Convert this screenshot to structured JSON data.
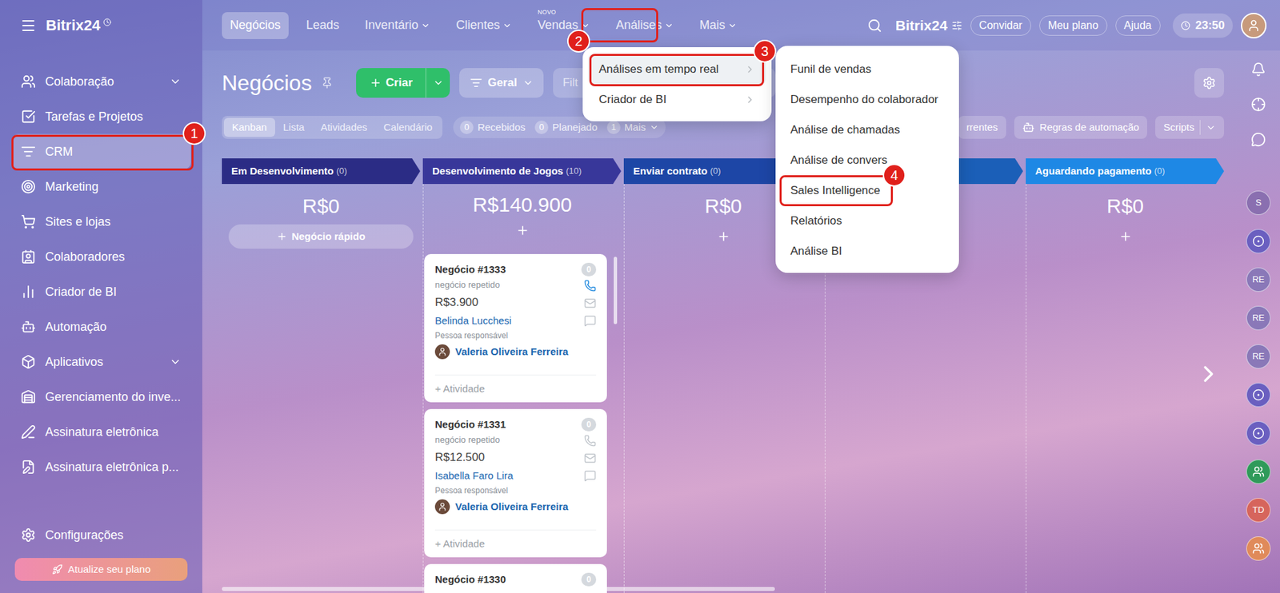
{
  "sidebar": {
    "logo": "Bitrix24",
    "items": [
      {
        "label": "Colaboração",
        "expandable": true,
        "selected": false
      },
      {
        "label": "Tarefas e Projetos",
        "expandable": false,
        "selected": false
      },
      {
        "label": "CRM",
        "expandable": false,
        "selected": true
      },
      {
        "label": "Marketing",
        "expandable": false,
        "selected": false
      },
      {
        "label": "Sites e lojas",
        "expandable": false,
        "selected": false
      },
      {
        "label": "Colaboradores",
        "expandable": false,
        "selected": false
      },
      {
        "label": "Criador de BI",
        "expandable": false,
        "selected": false
      },
      {
        "label": "Automação",
        "expandable": false,
        "selected": false
      },
      {
        "label": "Aplicativos",
        "expandable": true,
        "selected": false
      },
      {
        "label": "Gerenciamento do inve...",
        "expandable": false,
        "selected": false
      },
      {
        "label": "Assinatura eletrônica",
        "expandable": false,
        "selected": false
      },
      {
        "label": "Assinatura eletrônica p...",
        "expandable": false,
        "selected": false
      }
    ],
    "settings": "Configurações",
    "upgrade": "Atualize seu plano"
  },
  "topnav": {
    "tabs": [
      {
        "label": "Negócios",
        "selected": true,
        "dropdown": false,
        "badge": ""
      },
      {
        "label": "Leads",
        "selected": false,
        "dropdown": false,
        "badge": ""
      },
      {
        "label": "Inventário",
        "selected": false,
        "dropdown": true,
        "badge": ""
      },
      {
        "label": "Clientes",
        "selected": false,
        "dropdown": true,
        "badge": ""
      },
      {
        "label": "Vendas",
        "selected": false,
        "dropdown": true,
        "badge": "NOVO"
      },
      {
        "label": "Análises",
        "selected": false,
        "dropdown": true,
        "badge": ""
      },
      {
        "label": "Mais",
        "selected": false,
        "dropdown": true,
        "badge": ""
      }
    ],
    "brand": "Bitrix24",
    "buttons": [
      "Convidar",
      "Meu plano",
      "Ajuda"
    ],
    "time": "23:50"
  },
  "page": {
    "title": "Negócios",
    "create": "Criar",
    "preset": "Geral",
    "filter_placeholder": "Filt",
    "view_tabs": [
      {
        "label": "Kanban",
        "selected": true
      },
      {
        "label": "Lista",
        "selected": false
      },
      {
        "label": "Atividades",
        "selected": false
      },
      {
        "label": "Calendário",
        "selected": false
      }
    ],
    "counters": [
      {
        "count": "0",
        "label": "Recebidos",
        "dropdown": false
      },
      {
        "count": "0",
        "label": "Planejado",
        "dropdown": false
      },
      {
        "count": "1",
        "label": "Mais",
        "dropdown": true
      }
    ],
    "tools": [
      {
        "label": "rrentes",
        "dropdown": false
      },
      {
        "label": "Regras de automação",
        "dropdown": false
      },
      {
        "label": "Scripts",
        "dropdown": true
      }
    ]
  },
  "columns": [
    {
      "title": "Em Desenvolvimento",
      "count": "(0)",
      "amount": "R$0",
      "quick_add": "Negócio rápido",
      "color": "#2b2c85",
      "cards": []
    },
    {
      "title": "Desenvolvimento de Jogos",
      "count": "(10)",
      "amount": "R$140.900",
      "quick_add": "",
      "color": "#38379a",
      "cards": [
        {
          "title": "Negócio #1333",
          "count": "0",
          "subtitle": "negócio repetido",
          "amount": "R$3.900",
          "client": "Belinda Lucchesi",
          "role": "Pessoa responsável",
          "responsible": "Valeria Oliveira Ferreira",
          "action": "+ Atividade",
          "phone_active": true
        },
        {
          "title": "Negócio #1331",
          "count": "0",
          "subtitle": "negócio repetido",
          "amount": "R$12.500",
          "client": "Isabella Faro Lira",
          "role": "Pessoa responsável",
          "responsible": "Valeria Oliveira Ferreira",
          "action": "+ Atividade",
          "phone_active": false
        },
        {
          "title": "Negócio #1330",
          "count": "0",
          "subtitle": "",
          "amount": "",
          "client": "",
          "role": "",
          "responsible": "",
          "action": "",
          "phone_active": false
        }
      ]
    },
    {
      "title": "Enviar contrato",
      "count": "(0)",
      "amount": "R$0",
      "quick_add": "",
      "color": "#1d46a6",
      "cards": []
    },
    {
      "title": "",
      "count": "",
      "amount": "",
      "quick_add": "",
      "color": "#1b5fb8",
      "cards": []
    },
    {
      "title": "Aguardando pagamento",
      "count": "(0)",
      "amount": "R$0",
      "quick_add": "",
      "color": "#1e88e5",
      "cards": []
    }
  ],
  "analytics_menu": [
    {
      "label": "Análises em tempo real",
      "selected": true
    },
    {
      "label": "Criador de BI",
      "selected": false
    }
  ],
  "submenu": [
    "Funil de vendas",
    "Desempenho do colaborador",
    "Análise de chamadas",
    "Análise de convers",
    "Sales Intelligence",
    "Relatórios",
    "Análise BI"
  ],
  "annotations": [
    "1",
    "2",
    "3",
    "4"
  ],
  "rail": [
    {
      "kind": "bell",
      "label": "",
      "color": "#ffffff"
    },
    {
      "kind": "target",
      "label": "",
      "color": "#ffffff"
    },
    {
      "kind": "chat",
      "label": "",
      "color": "#ffffff"
    },
    {
      "kind": "avatar",
      "label": "S",
      "color": "#8a6fb0"
    },
    {
      "kind": "app",
      "label": "",
      "color": "#6a5fc0"
    },
    {
      "kind": "avatar",
      "label": "RE",
      "color": "#8a78b8"
    },
    {
      "kind": "avatar",
      "label": "RE",
      "color": "#8a78b8"
    },
    {
      "kind": "avatar",
      "label": "RE",
      "color": "#8a78b8"
    },
    {
      "kind": "app",
      "label": "",
      "color": "#6a5fc0"
    },
    {
      "kind": "app",
      "label": "",
      "color": "#6a5fc0"
    },
    {
      "kind": "person",
      "label": "",
      "color": "#2f9a5a"
    },
    {
      "kind": "avatar",
      "label": "TD",
      "color": "#d6655c"
    },
    {
      "kind": "person",
      "label": "",
      "color": "#e08a5a"
    }
  ]
}
